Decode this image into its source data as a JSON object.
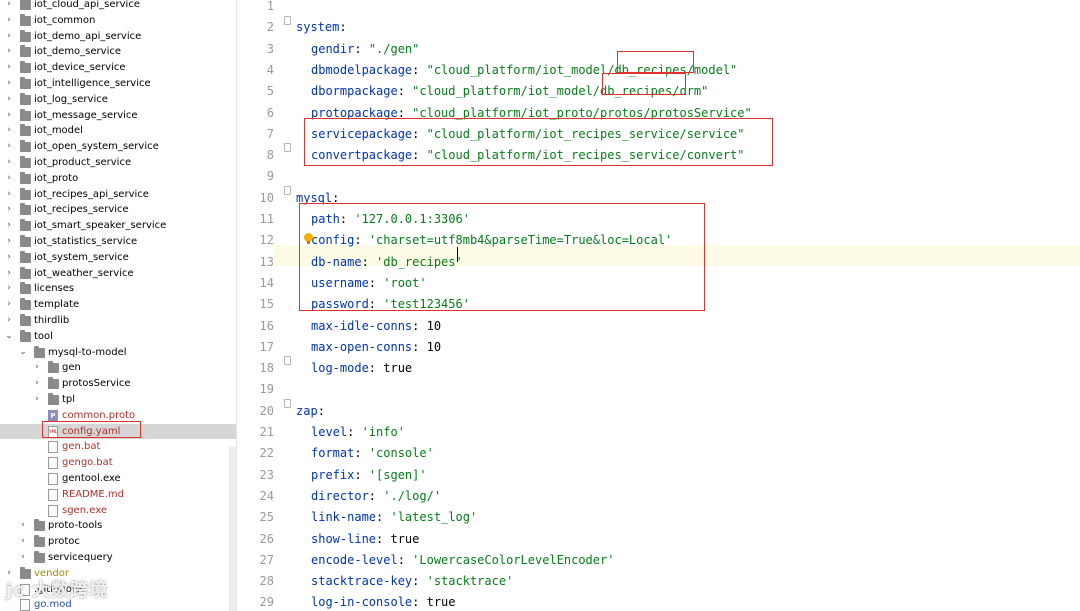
{
  "tree": [
    {
      "label": "iot_cloud_api_service",
      "depth": 0,
      "kind": "folder",
      "expanded": false
    },
    {
      "label": "iot_common",
      "depth": 0,
      "kind": "folder",
      "expanded": false
    },
    {
      "label": "iot_demo_api_service",
      "depth": 0,
      "kind": "folder",
      "expanded": false
    },
    {
      "label": "iot_demo_service",
      "depth": 0,
      "kind": "folder",
      "expanded": false
    },
    {
      "label": "iot_device_service",
      "depth": 0,
      "kind": "folder",
      "expanded": false
    },
    {
      "label": "iot_intelligence_service",
      "depth": 0,
      "kind": "folder",
      "expanded": false
    },
    {
      "label": "iot_log_service",
      "depth": 0,
      "kind": "folder",
      "expanded": false
    },
    {
      "label": "iot_message_service",
      "depth": 0,
      "kind": "folder",
      "expanded": false
    },
    {
      "label": "iot_model",
      "depth": 0,
      "kind": "folder",
      "expanded": false
    },
    {
      "label": "iot_open_system_service",
      "depth": 0,
      "kind": "folder",
      "expanded": false
    },
    {
      "label": "iot_product_service",
      "depth": 0,
      "kind": "folder",
      "expanded": false
    },
    {
      "label": "iot_proto",
      "depth": 0,
      "kind": "folder",
      "expanded": false
    },
    {
      "label": "iot_recipes_api_service",
      "depth": 0,
      "kind": "folder",
      "expanded": false
    },
    {
      "label": "iot_recipes_service",
      "depth": 0,
      "kind": "folder",
      "expanded": false
    },
    {
      "label": "iot_smart_speaker_service",
      "depth": 0,
      "kind": "folder",
      "expanded": false
    },
    {
      "label": "iot_statistics_service",
      "depth": 0,
      "kind": "folder",
      "expanded": false
    },
    {
      "label": "iot_system_service",
      "depth": 0,
      "kind": "folder",
      "expanded": false
    },
    {
      "label": "iot_weather_service",
      "depth": 0,
      "kind": "folder",
      "expanded": false
    },
    {
      "label": "licenses",
      "depth": 0,
      "kind": "folder",
      "expanded": false
    },
    {
      "label": "template",
      "depth": 0,
      "kind": "folder",
      "expanded": false
    },
    {
      "label": "thirdlib",
      "depth": 0,
      "kind": "folder",
      "expanded": false
    },
    {
      "label": "tool",
      "depth": 0,
      "kind": "folder",
      "expanded": true
    },
    {
      "label": "mysql-to-model",
      "depth": 1,
      "kind": "folder",
      "expanded": true
    },
    {
      "label": "gen",
      "depth": 2,
      "kind": "folder",
      "expanded": false
    },
    {
      "label": "protosService",
      "depth": 2,
      "kind": "folder",
      "expanded": false
    },
    {
      "label": "tpl",
      "depth": 2,
      "kind": "folder",
      "expanded": false
    },
    {
      "label": "common.proto",
      "depth": 2,
      "kind": "proto",
      "color": "red"
    },
    {
      "label": "config.yaml",
      "depth": 2,
      "kind": "yml",
      "color": "red",
      "selected": true
    },
    {
      "label": "gen.bat",
      "depth": 2,
      "kind": "file",
      "color": "red"
    },
    {
      "label": "gengo.bat",
      "depth": 2,
      "kind": "file",
      "color": "red"
    },
    {
      "label": "gentool.exe",
      "depth": 2,
      "kind": "file"
    },
    {
      "label": "README.md",
      "depth": 2,
      "kind": "file",
      "color": "red"
    },
    {
      "label": "sgen.exe",
      "depth": 2,
      "kind": "file",
      "color": "red"
    },
    {
      "label": "proto-tools",
      "depth": 1,
      "kind": "folder",
      "expanded": false
    },
    {
      "label": "protoc",
      "depth": 1,
      "kind": "folder",
      "expanded": false
    },
    {
      "label": "servicequery",
      "depth": 1,
      "kind": "folder",
      "expanded": false
    },
    {
      "label": "vendor",
      "depth": 0,
      "kind": "folder",
      "expanded": false,
      "color": "yellow"
    },
    {
      "label": ".gitignore",
      "depth": 0,
      "kind": "file"
    },
    {
      "label": "go.mod",
      "depth": 0,
      "kind": "file",
      "color": "blue"
    }
  ],
  "code": [
    {
      "n": "1",
      "parts": []
    },
    {
      "n": "2",
      "parts": [
        [
          "k-top",
          "system"
        ],
        [
          "v",
          ":"
        ]
      ]
    },
    {
      "n": "3",
      "parts": [
        [
          "k",
          "gendir"
        ],
        [
          "v",
          ": "
        ],
        [
          "s",
          "\"./gen\""
        ]
      ]
    },
    {
      "n": "4",
      "parts": [
        [
          "k",
          "dbmodelpackage"
        ],
        [
          "v",
          ": "
        ],
        [
          "s",
          "\"cloud_platform/iot_model/db_recipes/model\""
        ]
      ]
    },
    {
      "n": "5",
      "parts": [
        [
          "k",
          "dbormpackage"
        ],
        [
          "v",
          ": "
        ],
        [
          "s",
          "\"cloud_platform/iot_model/db_recipes/orm\""
        ]
      ]
    },
    {
      "n": "6",
      "parts": [
        [
          "k",
          "protopackage"
        ],
        [
          "v",
          ": "
        ],
        [
          "s",
          "\"cloud_platform/iot_proto/protos/protosService\""
        ]
      ]
    },
    {
      "n": "7",
      "parts": [
        [
          "k",
          "servicepackage"
        ],
        [
          "v",
          ": "
        ],
        [
          "s",
          "\"cloud_platform/iot_recipes_service/service\""
        ]
      ]
    },
    {
      "n": "8",
      "parts": [
        [
          "k",
          "convertpackage"
        ],
        [
          "v",
          ": "
        ],
        [
          "s",
          "\"cloud_platform/iot_recipes_service/convert\""
        ]
      ]
    },
    {
      "n": "9",
      "parts": []
    },
    {
      "n": "10",
      "parts": [
        [
          "k-top",
          "mysql"
        ],
        [
          "v",
          ":"
        ]
      ]
    },
    {
      "n": "11",
      "parts": [
        [
          "k",
          "path"
        ],
        [
          "v",
          ": "
        ],
        [
          "s",
          "'127.0.0.1:3306'"
        ]
      ]
    },
    {
      "n": "12",
      "parts": [
        [
          "k",
          "config"
        ],
        [
          "v",
          ": "
        ],
        [
          "s",
          "'charset=utf8mb4&parseTime=True&loc=Local'"
        ]
      ]
    },
    {
      "n": "13",
      "parts": [
        [
          "k",
          "db-name"
        ],
        [
          "v",
          ": "
        ],
        [
          "s",
          "'db_recipes'"
        ]
      ]
    },
    {
      "n": "14",
      "parts": [
        [
          "k",
          "username"
        ],
        [
          "v",
          ": "
        ],
        [
          "s",
          "'root'"
        ]
      ]
    },
    {
      "n": "15",
      "parts": [
        [
          "k",
          "password"
        ],
        [
          "v",
          ": "
        ],
        [
          "s",
          "'test123456'"
        ]
      ]
    },
    {
      "n": "16",
      "parts": [
        [
          "k",
          "max-idle-conns"
        ],
        [
          "v",
          ": 10"
        ]
      ]
    },
    {
      "n": "17",
      "parts": [
        [
          "k",
          "max-open-conns"
        ],
        [
          "v",
          ": 10"
        ]
      ]
    },
    {
      "n": "18",
      "parts": [
        [
          "k",
          "log-mode"
        ],
        [
          "v",
          ": true"
        ]
      ]
    },
    {
      "n": "19",
      "parts": []
    },
    {
      "n": "20",
      "parts": [
        [
          "k-top",
          "zap"
        ],
        [
          "v",
          ":"
        ]
      ]
    },
    {
      "n": "21",
      "parts": [
        [
          "k",
          "level"
        ],
        [
          "v",
          ": "
        ],
        [
          "s",
          "'info'"
        ]
      ]
    },
    {
      "n": "22",
      "parts": [
        [
          "k",
          "format"
        ],
        [
          "v",
          ": "
        ],
        [
          "s",
          "'console'"
        ]
      ]
    },
    {
      "n": "23",
      "parts": [
        [
          "k",
          "prefix"
        ],
        [
          "v",
          ": "
        ],
        [
          "s",
          "'[sgen]'"
        ]
      ]
    },
    {
      "n": "24",
      "parts": [
        [
          "k",
          "director"
        ],
        [
          "v",
          ": "
        ],
        [
          "s",
          "'./log/'"
        ]
      ]
    },
    {
      "n": "25",
      "parts": [
        [
          "k",
          "link-name"
        ],
        [
          "v",
          ": "
        ],
        [
          "s",
          "'latest_log'"
        ]
      ]
    },
    {
      "n": "26",
      "parts": [
        [
          "k",
          "show-line"
        ],
        [
          "v",
          ": true"
        ]
      ]
    },
    {
      "n": "27",
      "parts": [
        [
          "k",
          "encode-level"
        ],
        [
          "v",
          ": "
        ],
        [
          "s",
          "'LowercaseColorLevelEncoder'"
        ]
      ]
    },
    {
      "n": "28",
      "parts": [
        [
          "k",
          "stacktrace-key"
        ],
        [
          "v",
          ": "
        ],
        [
          "s",
          "'stacktrace'"
        ]
      ]
    },
    {
      "n": "29",
      "parts": [
        [
          "k",
          "log-in-console"
        ],
        [
          "v",
          ": true"
        ]
      ]
    }
  ],
  "watermark": "jc 大数跨境"
}
